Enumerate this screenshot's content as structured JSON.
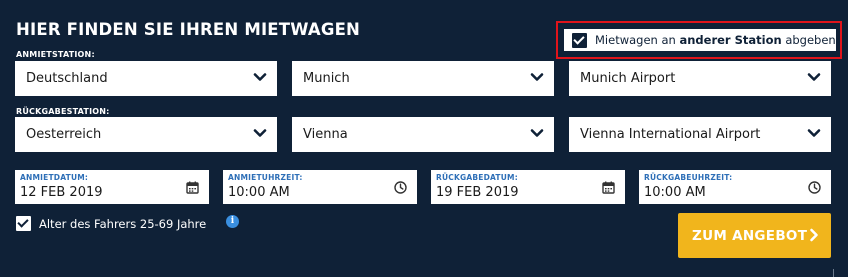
{
  "title": "HIER FINDEN SIE IHREN MIETWAGEN",
  "return_option": {
    "prefix": "Mietwagen an ",
    "bold": "anderer Station",
    "suffix": " abgeben",
    "checked": true
  },
  "pickup": {
    "label": "ANMIETSTATION:",
    "country": "Deutschland",
    "city": "Munich",
    "station": "Munich Airport"
  },
  "dropoff": {
    "label": "RÜCKGABESTATION:",
    "country": "Oesterreich",
    "city": "Vienna",
    "station": "Vienna International Airport"
  },
  "dates": {
    "pickup_date_label": "ANMIETDATUM:",
    "pickup_date": "12 FEB 2019",
    "pickup_time_label": "ANMIETUHRZEIT:",
    "pickup_time": "10:00 AM",
    "return_date_label": "RÜCKGABEDATUM:",
    "return_date": "19 FEB 2019",
    "return_time_label": "RÜCKGABEUHRZEIT:",
    "return_time": "10:00 AM"
  },
  "driver_age": {
    "label": "Alter des Fahrers 25-69 Jahre",
    "checked": true,
    "info_icon": "info-icon"
  },
  "submit_label": "ZUM ANGEBOT",
  "colors": {
    "background": "#0f2137",
    "accent": "#f1b51c",
    "label_blue": "#2e6fb7",
    "highlight_red": "#e0141b"
  }
}
